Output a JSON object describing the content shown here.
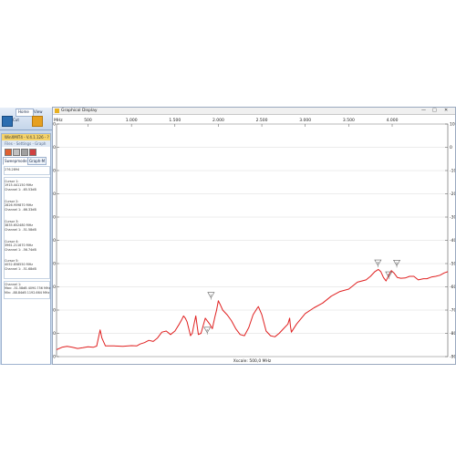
{
  "app": {
    "ribbon_tabs": [
      "Home",
      "View"
    ],
    "cut_label": "Cut",
    "window_title": "WinXMIT4 - V.4.1.126 - ?",
    "menu": "Files - Settings - Graph",
    "tabs": [
      "Sweepmode",
      "Graph-M"
    ],
    "info_lines": [
      "276.2894"
    ],
    "cursors": [
      {
        "name": "Cursor 1:",
        "freq": "1915.441150 MHz",
        "channel": "Channel 1: -65.53dB"
      },
      {
        "name": "Cursor 2:",
        "freq": "2826.959870 MHz",
        "channel": "Channel 1: -66.33dB"
      },
      {
        "name": "Cursor 3:",
        "freq": "3835.652480 MHz",
        "channel": "Channel 1: -51.58dB"
      },
      {
        "name": "Cursor 4:",
        "freq": "3961.211670 MHz",
        "channel": "Channel 1: -56.74dB"
      },
      {
        "name": "Cursor 5:",
        "freq": "4052.858550 MHz",
        "channel": "Channel 1: -51.68dB"
      }
    ],
    "channel_summary": {
      "title": "Channel 1:",
      "max": "Max: -51.58dB 4090.756 MHz",
      "min": "Min: -88.84dB 1192.664 MHz"
    }
  },
  "graph_window": {
    "title": "Graphical Display",
    "controls": [
      "—",
      "□",
      "✕"
    ]
  },
  "chart_data": {
    "type": "line",
    "x_unit_label": "MHz",
    "xlabel": "Xscale: 500,0 MHz",
    "xlim": [
      138,
      4640
    ],
    "ylim": [
      -90,
      10
    ],
    "x_ticks": [
      [
        "500",
        500
      ],
      [
        "1.000",
        1000
      ],
      [
        "1.500",
        1500
      ],
      [
        "2.000",
        2000
      ],
      [
        "2.500",
        2500
      ],
      [
        "3.000",
        3000
      ],
      [
        "3.500",
        3500
      ],
      [
        "4.000",
        4000
      ]
    ],
    "y_ticks": [
      10,
      0,
      -10,
      -20,
      -30,
      -40,
      -50,
      -60,
      -70,
      -80,
      -90
    ],
    "grid": "horizontal",
    "line_color": "#e02020",
    "series": [
      {
        "x": [
          138,
          200,
          260,
          320,
          380,
          440,
          500,
          560,
          600,
          620,
          640,
          660,
          700,
          800,
          900,
          1000,
          1060,
          1100,
          1150,
          1200,
          1250,
          1300,
          1350,
          1400,
          1450,
          1500,
          1550,
          1580,
          1600,
          1620,
          1640,
          1660,
          1680,
          1700,
          1720,
          1740,
          1770,
          1800,
          1850,
          1900,
          1930,
          1960,
          1980,
          2000,
          2020,
          2050,
          2100,
          2150,
          2200,
          2250,
          2300,
          2350,
          2400,
          2450,
          2460,
          2500,
          2550,
          2600,
          2650,
          2700,
          2750,
          2800,
          2820,
          2830,
          2840,
          2900,
          3000,
          3100,
          3200,
          3300,
          3400,
          3500,
          3600,
          3700,
          3750,
          3800,
          3840,
          3870,
          3900,
          3930,
          3960,
          3990,
          4020,
          4060,
          4100,
          4150,
          4200,
          4250,
          4300,
          4360,
          4400,
          4450,
          4500,
          4550,
          4600,
          4640
        ],
        "y": [
          -87,
          -86,
          -85.6,
          -86,
          -86.5,
          -86.2,
          -85.8,
          -86,
          -85.5,
          -82,
          -78.5,
          -82,
          -85.4,
          -85.4,
          -85.6,
          -85.3,
          -85.4,
          -84.6,
          -84,
          -83,
          -83.5,
          -82,
          -79.5,
          -79,
          -80.5,
          -79,
          -76,
          -74,
          -72.5,
          -73.5,
          -75,
          -78,
          -81,
          -80,
          -76,
          -72.5,
          -80.5,
          -80,
          -73.5,
          -76,
          -78,
          -73,
          -70,
          -66,
          -67.5,
          -70,
          -72,
          -74.5,
          -78,
          -80.5,
          -81,
          -77.5,
          -72,
          -69,
          -68.5,
          -72,
          -79,
          -81,
          -81.5,
          -80,
          -78,
          -76,
          -73.5,
          -77,
          -79.5,
          -76,
          -71.5,
          -69,
          -67,
          -64,
          -62,
          -61,
          -58,
          -57,
          -55.5,
          -53.5,
          -52.5,
          -53.5,
          -56,
          -57.5,
          -55,
          -53,
          -54,
          -56,
          -56.3,
          -56.2,
          -55.5,
          -55.5,
          -57,
          -56.5,
          -56.5,
          -55.8,
          -55.5,
          -55,
          -54,
          -53.5
        ]
      }
    ],
    "markers": [
      {
        "label": "1",
        "x": 1915.4,
        "y": -65.5
      },
      {
        "label": "2",
        "x": 1872,
        "y": -80.5
      },
      {
        "label": "3",
        "x": 3835.7,
        "y": -51.6
      },
      {
        "label": "4",
        "x": 3961.2,
        "y": -56.7
      },
      {
        "label": "5",
        "x": 4052.9,
        "y": -51.7
      }
    ]
  }
}
